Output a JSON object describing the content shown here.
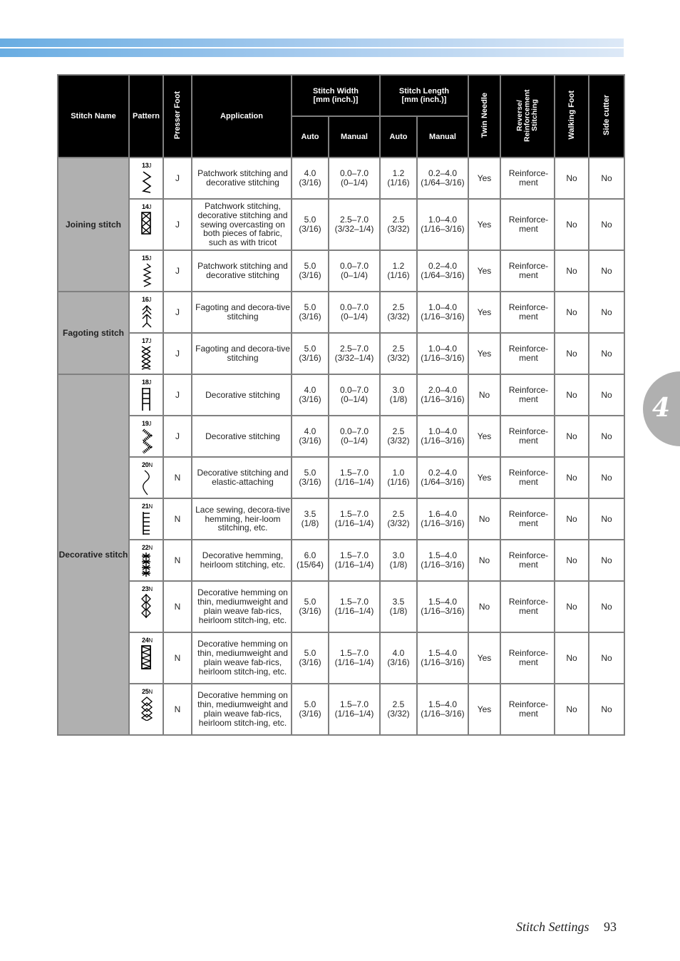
{
  "header_band": {
    "colors": [
      "#69ade2",
      "#dde9f7"
    ]
  },
  "table": {
    "headers": {
      "stitch_name": "Stitch Name",
      "pattern": "Pattern",
      "presser_foot": "Presser Foot",
      "application": "Application",
      "stitch_width": "Stitch Width\n[mm (inch.)]",
      "stitch_length": "Stitch Length\n[mm (inch.)]",
      "auto": "Auto",
      "manual": "Manual",
      "twin_needle": "Twin Needle",
      "reverse": "Reverse/ Reinforcement Stitching",
      "walking_foot": "Walking Foot",
      "side_cutter": "Side cutter"
    },
    "groups": [
      {
        "name": "Joining stitch",
        "rows": 3
      },
      {
        "name": "Fagoting stitch",
        "rows": 2
      },
      {
        "name": "Decorative stitch",
        "rows": 8
      }
    ],
    "rows": [
      {
        "num": "13",
        "foot_code": "J",
        "glyph": "zigzag-wave",
        "foot": "J",
        "application": "Patchwork stitching and decorative stitching",
        "w_auto": [
          "4.0",
          "(3/16)"
        ],
        "w_manual": [
          "0.0–7.0",
          "(0–1/4)"
        ],
        "l_auto": [
          "1.2",
          "(1/16)"
        ],
        "l_manual": [
          "0.2–4.0",
          "(1/64–3/16)"
        ],
        "twin": "Yes",
        "reverse": "Reinforce-\nment",
        "walking": "No",
        "cutter": "No"
      },
      {
        "num": "14",
        "foot_code": "J",
        "glyph": "crossed-box",
        "foot": "J",
        "application": "Patchwork stitching, decorative stitching and sewing overcasting on both pieces of fabric, such as with tricot",
        "w_auto": [
          "5.0",
          "(3/16)"
        ],
        "w_manual": [
          "2.5–7.0",
          "(3/32–1/4)"
        ],
        "l_auto": [
          "2.5",
          "(3/32)"
        ],
        "l_manual": [
          "1.0–4.0",
          "(1/16–3/16)"
        ],
        "twin": "Yes",
        "reverse": "Reinforce-\nment",
        "walking": "No",
        "cutter": "No"
      },
      {
        "num": "15",
        "foot_code": "J",
        "glyph": "small-zigzag",
        "foot": "J",
        "application": "Patchwork stitching and decorative stitching",
        "w_auto": [
          "5.0",
          "(3/16)"
        ],
        "w_manual": [
          "0.0–7.0",
          "(0–1/4)"
        ],
        "l_auto": [
          "1.2",
          "(1/16)"
        ],
        "l_manual": [
          "0.2–4.0",
          "(1/64–3/16)"
        ],
        "twin": "Yes",
        "reverse": "Reinforce-\nment",
        "walking": "No",
        "cutter": "No"
      },
      {
        "num": "16",
        "foot_code": "J",
        "glyph": "chevrons",
        "foot": "J",
        "application": "Fagoting and decora-tive stitching",
        "w_auto": [
          "5.0",
          "(3/16)"
        ],
        "w_manual": [
          "0.0–7.0",
          "(0–1/4)"
        ],
        "l_auto": [
          "2.5",
          "(3/32)"
        ],
        "l_manual": [
          "1.0–4.0",
          "(1/16–3/16)"
        ],
        "twin": "Yes",
        "reverse": "Reinforce-\nment",
        "walking": "No",
        "cutter": "No"
      },
      {
        "num": "17",
        "foot_code": "J",
        "glyph": "cross-stitches",
        "foot": "J",
        "application": "Fagoting and decora-tive stitching",
        "w_auto": [
          "5.0",
          "(3/16)"
        ],
        "w_manual": [
          "2.5–7.0",
          "(3/32–1/4)"
        ],
        "l_auto": [
          "2.5",
          "(3/32)"
        ],
        "l_manual": [
          "1.0–4.0",
          "(1/16–3/16)"
        ],
        "twin": "Yes",
        "reverse": "Reinforce-\nment",
        "walking": "No",
        "cutter": "No"
      },
      {
        "num": "18",
        "foot_code": "J",
        "glyph": "ladder",
        "foot": "J",
        "application": "Decorative stitching",
        "w_auto": [
          "4.0",
          "(3/16)"
        ],
        "w_manual": [
          "0.0–7.0",
          "(0–1/4)"
        ],
        "l_auto": [
          "3.0",
          "(1/8)"
        ],
        "l_manual": [
          "2.0–4.0",
          "(1/16–3/16)"
        ],
        "twin": "No",
        "reverse": "Reinforce-\nment",
        "walking": "No",
        "cutter": "No"
      },
      {
        "num": "19",
        "foot_code": "J",
        "glyph": "satin-zigzag",
        "foot": "J",
        "application": "Decorative stitching",
        "w_auto": [
          "4.0",
          "(3/16)"
        ],
        "w_manual": [
          "0.0–7.0",
          "(0–1/4)"
        ],
        "l_auto": [
          "2.5",
          "(3/32)"
        ],
        "l_manual": [
          "1.0–4.0",
          "(1/16–3/16)"
        ],
        "twin": "Yes",
        "reverse": "Reinforce-\nment",
        "walking": "No",
        "cutter": "No"
      },
      {
        "num": "20",
        "foot_code": "N",
        "glyph": "serpentine",
        "foot": "N",
        "application": "Decorative stitching and elastic-attaching",
        "w_auto": [
          "5.0",
          "(3/16)"
        ],
        "w_manual": [
          "1.5–7.0",
          "(1/16–1/4)"
        ],
        "l_auto": [
          "1.0",
          "(1/16)"
        ],
        "l_manual": [
          "0.2–4.0",
          "(1/64–3/16)"
        ],
        "twin": "Yes",
        "reverse": "Reinforce-\nment",
        "walking": "No",
        "cutter": "No"
      },
      {
        "num": "21",
        "foot_code": "N",
        "glyph": "comb",
        "foot": "N",
        "application": "Lace sewing, decora-tive hemming, heir-loom stitching, etc.",
        "w_auto": [
          "3.5",
          "(1/8)"
        ],
        "w_manual": [
          "1.5–7.0",
          "(1/16–1/4)"
        ],
        "l_auto": [
          "2.5",
          "(3/32)"
        ],
        "l_manual": [
          "1.6–4.0",
          "(1/16–3/16)"
        ],
        "twin": "No",
        "reverse": "Reinforce-\nment",
        "walking": "No",
        "cutter": "No"
      },
      {
        "num": "22",
        "foot_code": "N",
        "glyph": "stars",
        "foot": "N",
        "application": "Decorative hemming, heirloom stitching, etc.",
        "w_auto": [
          "6.0",
          "(15/64)"
        ],
        "w_manual": [
          "1.5–7.0",
          "(1/16–1/4)"
        ],
        "l_auto": [
          "3.0",
          "(1/8)"
        ],
        "l_manual": [
          "1.5–4.0",
          "(1/16–3/16)"
        ],
        "twin": "No",
        "reverse": "Reinforce-\nment",
        "walking": "No",
        "cutter": "No"
      },
      {
        "num": "23",
        "foot_code": "N",
        "glyph": "diamonds-line",
        "foot": "N",
        "application": "Decorative hemming on thin, mediumweight and plain weave fab-rics, heirloom stitch-ing, etc.",
        "w_auto": [
          "5.0",
          "(3/16)"
        ],
        "w_manual": [
          "1.5–7.0",
          "(1/16–1/4)"
        ],
        "l_auto": [
          "3.5",
          "(1/8)"
        ],
        "l_manual": [
          "1.5–4.0",
          "(1/16–3/16)"
        ],
        "twin": "No",
        "reverse": "Reinforce-\nment",
        "walking": "No",
        "cutter": "No"
      },
      {
        "num": "24",
        "foot_code": "N",
        "glyph": "box-zigzag",
        "foot": "N",
        "application": "Decorative hemming on thin, mediumweight and plain weave fab-rics, heirloom stitch-ing, etc.",
        "w_auto": [
          "5.0",
          "(3/16)"
        ],
        "w_manual": [
          "1.5–7.0",
          "(1/16–1/4)"
        ],
        "l_auto": [
          "4.0",
          "(3/16)"
        ],
        "l_manual": [
          "1.5–4.0",
          "(1/16–3/16)"
        ],
        "twin": "Yes",
        "reverse": "Reinforce-\nment",
        "walking": "No",
        "cutter": "No"
      },
      {
        "num": "25",
        "foot_code": "N",
        "glyph": "diamond-chain",
        "foot": "N",
        "application": "Decorative hemming on thin, mediumweight and plain weave fab-rics, heirloom stitch-ing, etc.",
        "w_auto": [
          "5.0",
          "(3/16)"
        ],
        "w_manual": [
          "1.5–7.0",
          "(1/16–1/4)"
        ],
        "l_auto": [
          "2.5",
          "(3/32)"
        ],
        "l_manual": [
          "1.5–4.0",
          "(1/16–3/16)"
        ],
        "twin": "Yes",
        "reverse": "Reinforce-\nment",
        "walking": "No",
        "cutter": "No"
      }
    ]
  },
  "chapter_tab": {
    "number": "4",
    "color": "#b0b0b0"
  },
  "footer": {
    "title": "Stitch Settings",
    "page": "93"
  }
}
